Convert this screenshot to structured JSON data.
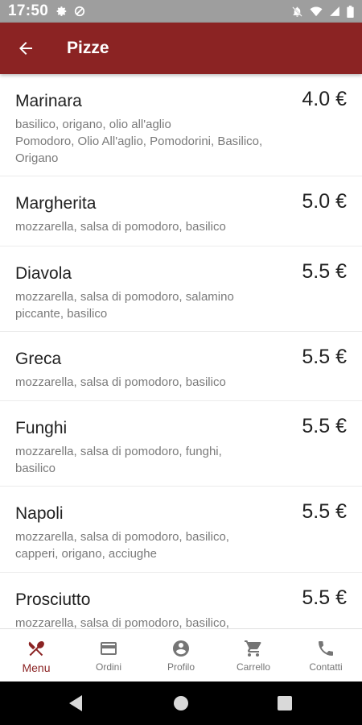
{
  "status_bar": {
    "time": "17:50"
  },
  "app_bar": {
    "title": "Pizze",
    "back_icon": "arrow-back-icon"
  },
  "pizzas": [
    {
      "name": "Marinara",
      "price": "4.0 €",
      "description": [
        "basilico, origano, olio all'aglio",
        "Pomodoro, Olio All'aglio, Pomodorini, Basilico,",
        "Origano"
      ]
    },
    {
      "name": "Margherita",
      "price": "5.0 €",
      "description": [
        "mozzarella, salsa di pomodoro, basilico"
      ]
    },
    {
      "name": "Diavola",
      "price": "5.5 €",
      "description": [
        "mozzarella, salsa di pomodoro, salamino",
        "piccante, basilico"
      ]
    },
    {
      "name": "Greca",
      "price": "5.5 €",
      "description": [
        "mozzarella, salsa di pomodoro, basilico"
      ]
    },
    {
      "name": "Funghi",
      "price": "5.5 €",
      "description": [
        "mozzarella, salsa di pomodoro, funghi,",
        "basilico"
      ]
    },
    {
      "name": "Napoli",
      "price": "5.5 €",
      "description": [
        "mozzarella, salsa di pomodoro, basilico,",
        "capperi, origano, acciughe"
      ]
    },
    {
      "name": "Prosciutto",
      "price": "5.5 €",
      "description": [
        "mozzarella, salsa di pomodoro, basilico,"
      ]
    }
  ],
  "bottom_nav": [
    {
      "label": "Menu",
      "icon": "fork-knife-icon",
      "active": true
    },
    {
      "label": "Ordini",
      "icon": "credit-card-icon",
      "active": false
    },
    {
      "label": "Profilo",
      "icon": "account-circle-icon",
      "active": false
    },
    {
      "label": "Carrello",
      "icon": "shopping-cart-icon",
      "active": false
    },
    {
      "label": "Contatti",
      "icon": "phone-icon",
      "active": false
    }
  ],
  "colors": {
    "primary": "#8b2323",
    "status_bar": "#9e9e9e",
    "text_primary": "#212121",
    "text_secondary": "#7a7a7a",
    "nav_inactive": "#757575"
  }
}
